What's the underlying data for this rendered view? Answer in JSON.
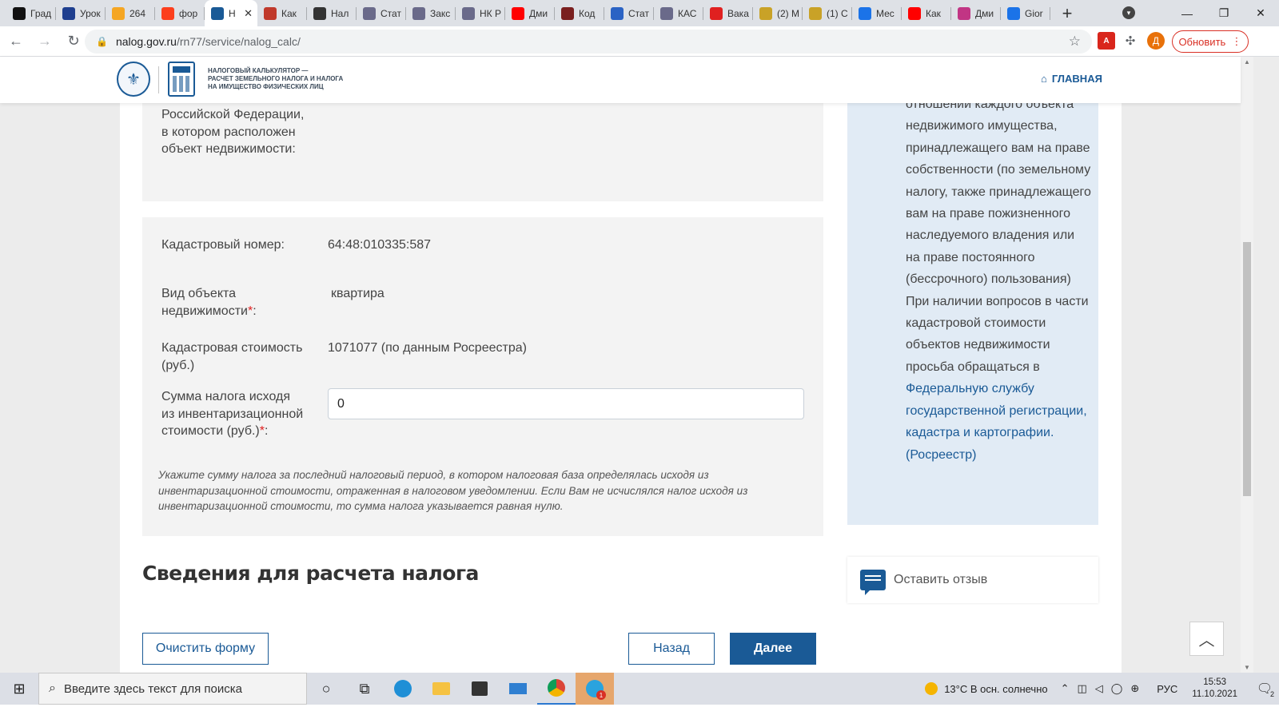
{
  "browser": {
    "tabs": [
      {
        "label": "Град",
        "icon": "investing-icon",
        "color": "#111111"
      },
      {
        "label": "Урок",
        "icon": "uk-flag-icon",
        "color": "#1f3f8f"
      },
      {
        "label": "264",
        "icon": "mail-icon",
        "color": "#f5a623"
      },
      {
        "label": "фор",
        "icon": "yandex-icon",
        "color": "#fc3f1d"
      },
      {
        "label": "Н",
        "icon": "nalog-icon",
        "color": "#1a5a96",
        "active": true
      },
      {
        "label": "Как",
        "icon": "hh-icon",
        "color": "#c0392b"
      },
      {
        "label": "Нал",
        "icon": "doc-icon",
        "color": "#333333"
      },
      {
        "label": "Стат",
        "icon": "nalog-icon",
        "color": "#6a6a8a"
      },
      {
        "label": "Закс",
        "icon": "nalog-icon",
        "color": "#6a6a8a"
      },
      {
        "label": "НК Р",
        "icon": "nalog-icon",
        "color": "#6a6a8a"
      },
      {
        "label": "Дми",
        "icon": "youtube-icon",
        "color": "#ff0000"
      },
      {
        "label": "Код",
        "icon": "book-icon",
        "color": "#7a1f1f"
      },
      {
        "label": "Стат",
        "icon": "flag-icon",
        "color": "#2b63c4"
      },
      {
        "label": "КАС",
        "icon": "nalog-icon",
        "color": "#6a6a8a"
      },
      {
        "label": "Вака",
        "icon": "hh-icon",
        "color": "#e02020"
      },
      {
        "label": "(2) М",
        "icon": "shield-icon",
        "color": "#c9a227"
      },
      {
        "label": "(1) С",
        "icon": "shield-icon",
        "color": "#c9a227"
      },
      {
        "label": "Мес",
        "icon": "pause-icon",
        "color": "#1b73e8"
      },
      {
        "label": "Как",
        "icon": "youtube-icon",
        "color": "#ff0000"
      },
      {
        "label": "Дми",
        "icon": "instagram-icon",
        "color": "#c13584"
      },
      {
        "label": "Gior",
        "icon": "pause-icon",
        "color": "#1b73e8"
      }
    ],
    "url_host": "nalog.gov.ru",
    "url_path": "/rn77/service/nalog_calc/",
    "update_label": "Обновить",
    "avatar_letter": "Д"
  },
  "header": {
    "title_lines": [
      "НАЛОГОВЫЙ КАЛЬКУЛЯТОР —",
      "РАСЧЕТ ЗЕМЕЛЬНОГО НАЛОГА И НАЛОГА",
      "НА ИМУЩЕСТВО ФИЗИЧЕСКИХ ЛИЦ"
    ],
    "nav_home": "ГЛАВНАЯ"
  },
  "form": {
    "region_label_partial": "Российской Федерации, в котором расположен объект недвижимости:",
    "cadastral_number_label": "Кадастровый номер:",
    "cadastral_number_value": "64:48:010335:587",
    "object_type_label": "Вид объекта недвижимости",
    "object_type_value": "квартира",
    "cadastral_value_label": "Кадастровая стоимость (руб.)",
    "cadastral_value_value": "1071077 (по данным Росреестра)",
    "tax_sum_label": "Сумма налога исходя из инвентаризационной стоимости (руб.)",
    "tax_sum_value": "0",
    "required_mark": "*",
    "colon": ":",
    "hint": "Укажите сумму налога за последний налоговый период, в котором налоговая база определялась исходя из инвентаризационной стоимости, отраженная в налоговом уведомлении. Если Вам не исчислялся налог исходя из инвентаризационной стоимости, то сумма налога указывается равная нулю."
  },
  "section_title": "Сведения для расчета налога",
  "buttons": {
    "clear": "Очистить форму",
    "back": "Назад",
    "next": "Далее"
  },
  "info": {
    "text_before_link": "отношении каждого объекта недвижимого имущества, принадлежащего вам на праве собственности (по земельному налогу, также принадлежащего вам на праве пожизненного наследуемого владения или на праве постоянного (бессрочного) пользования) При наличии вопросов в части кадастровой стоимости объектов недвижимости просьба обращаться в ",
    "link_text": "Федеральную службу государственной регистрации, кадастра и картографии. (Росреестр)"
  },
  "feedback_label": "Оставить отзыв",
  "taskbar": {
    "search_placeholder": "Введите здесь текст для поиска",
    "weather": "13°C  В осн. солнечно",
    "lang": "РУС",
    "time": "15:53",
    "date": "11.10.2021",
    "telegram_badge": "1",
    "notif_count": "2"
  },
  "colors": {
    "brand_blue": "#1a5a96",
    "info_bg": "#e1ebf5",
    "required_red": "#e02020"
  }
}
